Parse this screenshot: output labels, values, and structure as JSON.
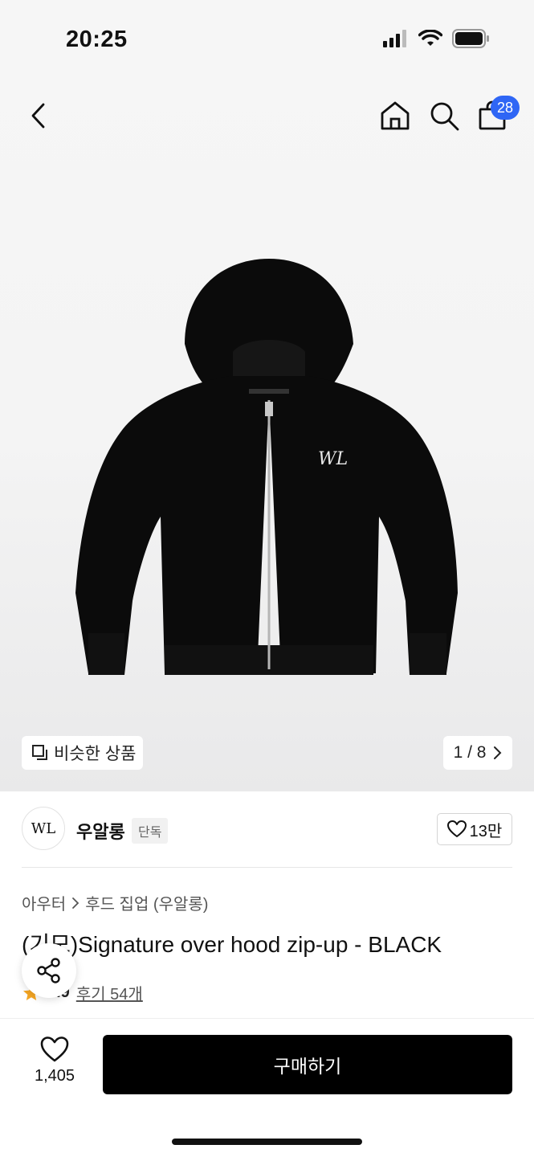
{
  "status_bar": {
    "time": "20:25",
    "icons": [
      "signal-icon",
      "wifi-icon",
      "battery-icon"
    ]
  },
  "nav": {
    "cart_count": "28",
    "icons": [
      "back-icon",
      "home-icon",
      "search-icon",
      "shopping-bag-icon"
    ]
  },
  "gallery": {
    "similar_label": "비슷한 상품",
    "page_indicator": "1 / 8"
  },
  "brand": {
    "logo_text": "WL",
    "name": "우알롱",
    "tag": "단독",
    "likes": "13만"
  },
  "breadcrumb": {
    "category": "아우터",
    "subcategory": "후드 집업 (우알롱)"
  },
  "product": {
    "title": "(기모)Signature over hood zip-up - BLACK",
    "rating": "4.9",
    "reviews": "후기 54개"
  },
  "bottom_bar": {
    "wish_count": "1,405",
    "buy_label": "구매하기"
  },
  "colors": {
    "accent_blue": "#2f66f5",
    "star": "#f5a623",
    "buy_button": "#000000"
  }
}
